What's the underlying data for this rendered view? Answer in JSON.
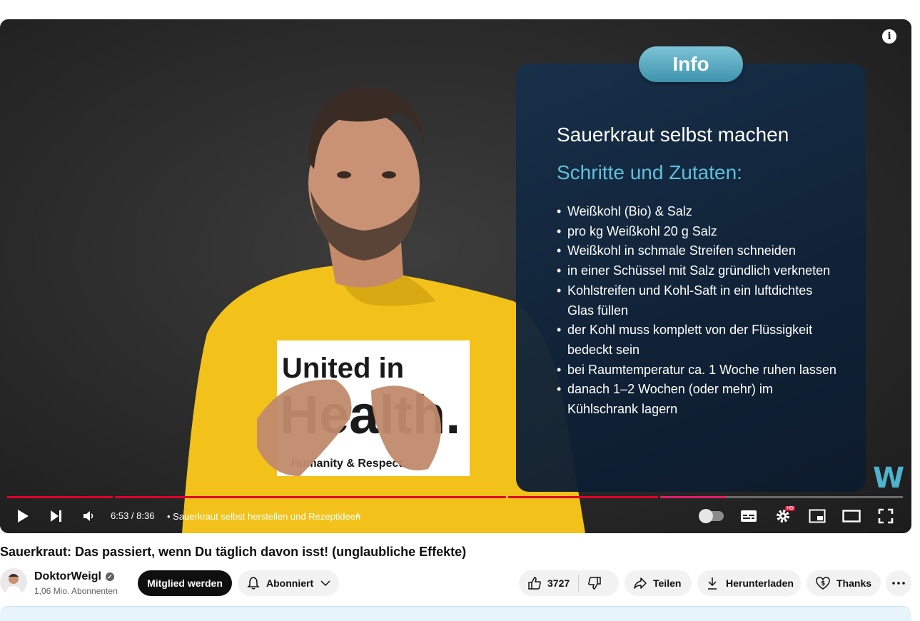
{
  "player": {
    "info_pill": "Info",
    "info_title": "Sauerkraut selbst machen",
    "info_subtitle": "Schritte und Zutaten:",
    "info_items": [
      "Weißkohl (Bio) & Salz",
      "pro kg Weißkohl 20 g Salz",
      "Weißkohl in schmale Streifen schneiden",
      "in einer Schüssel mit Salz gründlich verkneten",
      "Kohlstreifen und Kohl-Saft in ein luftdichtes Glas füllen",
      "der Kohl muss komplett von der Flüssigkeit bedeckt sein",
      "bei Raumtemperatur ca. 1 Woche ruhen lassen",
      "danach 1–2 Wochen (oder mehr) im Kühlschrank lagern"
    ],
    "shirt_line1": "United in",
    "shirt_line2": "Health.",
    "shirt_line3": "Humanity & Respect.",
    "brand_logo": "W",
    "info_icon": "i",
    "time": "6:53 / 8:36",
    "chapter": "• Sauerkraut selbst herstellen und Rezeptideen",
    "progress_fraction": 0.8,
    "hd_badge": "HD"
  },
  "video": {
    "title": "Sauerkraut: Das passiert, wenn Du täglich davon isst! (unglaubliche Effekte)"
  },
  "channel": {
    "name": "DoktorWeigl",
    "subscribers": "1,06 Mio. Abonnenten",
    "join_label": "Mitglied werden",
    "subscribed_label": "Abonniert"
  },
  "actions": {
    "likes": "3727",
    "share": "Teilen",
    "download": "Herunterladen",
    "thanks": "Thanks"
  },
  "colors": {
    "progress_red": "#e1002d",
    "info_accent": "#5fbfdc",
    "shirt_yellow": "#f2c21b"
  }
}
